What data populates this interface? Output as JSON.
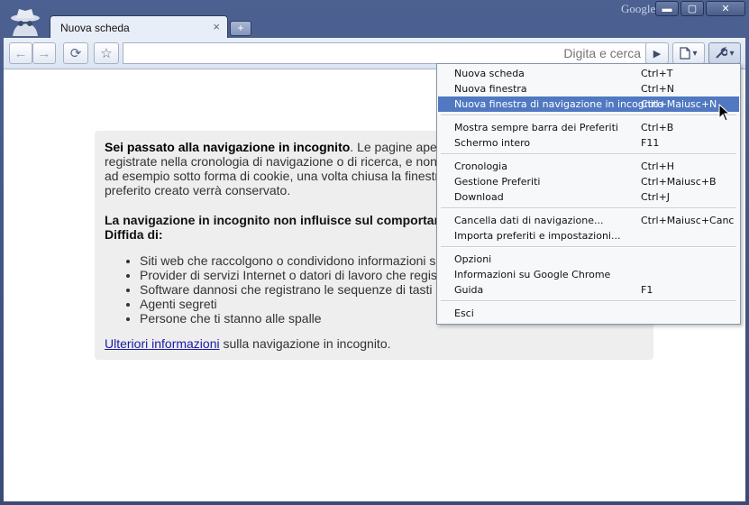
{
  "window": {
    "brand": "Google",
    "controls": {
      "minimize": "▬",
      "maximize": "▢",
      "close": "✕"
    }
  },
  "tab": {
    "title": "Nuova scheda",
    "close": "×",
    "new_tab": "+"
  },
  "toolbar": {
    "back": "←",
    "forward": "→",
    "reload": "⟳",
    "star": "☆",
    "omnibox_placeholder": "Digita e cerca",
    "go": "▶",
    "page": "▾",
    "wrench": "▾"
  },
  "incognito": {
    "intro_bold": "Sei passato alla navigazione in incognito",
    "intro_rest": ". Le pagine aperte",
    "intro_line2": "registrate nella cronologia di navigazione o di ricerca, e non lasc",
    "intro_line3": "ad esempio sotto forma di cookie, una volta chiusa la finestra. T",
    "intro_line4": "preferito creato verrà conservato.",
    "warning_line1": "La navigazione in incognito non influisce sul comportame",
    "warning_line2": "Diffida di:",
    "risks": [
      "Siti web che raccolgono o condividono informazioni su di",
      "Provider di servizi Internet o datori di lavoro che registrano",
      "Software dannosi che registrano le sequenze di tasti da t",
      "Agenti segreti",
      "Persone che ti stanno alle spalle"
    ],
    "learn_more_link": "Ulteriori informazioni",
    "learn_more_rest": " sulla navigazione in incognito."
  },
  "menu": {
    "items": [
      {
        "label": "Nuova scheda",
        "shortcut": "Ctrl+T"
      },
      {
        "label": "Nuova finestra",
        "shortcut": "Ctrl+N"
      },
      {
        "label": "Nuova finestra di navigazione in incognito",
        "shortcut": "Ctrl+Maiusc+N"
      },
      {
        "label": "Mostra sempre barra dei Preferiti",
        "shortcut": "Ctrl+B"
      },
      {
        "label": "Schermo intero",
        "shortcut": "F11"
      },
      {
        "label": "Cronologia",
        "shortcut": "Ctrl+H"
      },
      {
        "label": "Gestione Preferiti",
        "shortcut": "Ctrl+Maiusc+B"
      },
      {
        "label": "Download",
        "shortcut": "Ctrl+J"
      },
      {
        "label": "Cancella dati di navigazione...",
        "shortcut": "Ctrl+Maiusc+Canc"
      },
      {
        "label": "Importa preferiti e impostazioni...",
        "shortcut": ""
      },
      {
        "label": "Opzioni",
        "shortcut": ""
      },
      {
        "label": "Informazioni su Google Chrome",
        "shortcut": ""
      },
      {
        "label": "Guida",
        "shortcut": "F1"
      },
      {
        "label": "Esci",
        "shortcut": ""
      }
    ],
    "highlighted_index": 2,
    "highlight_color": "#5179c2"
  }
}
